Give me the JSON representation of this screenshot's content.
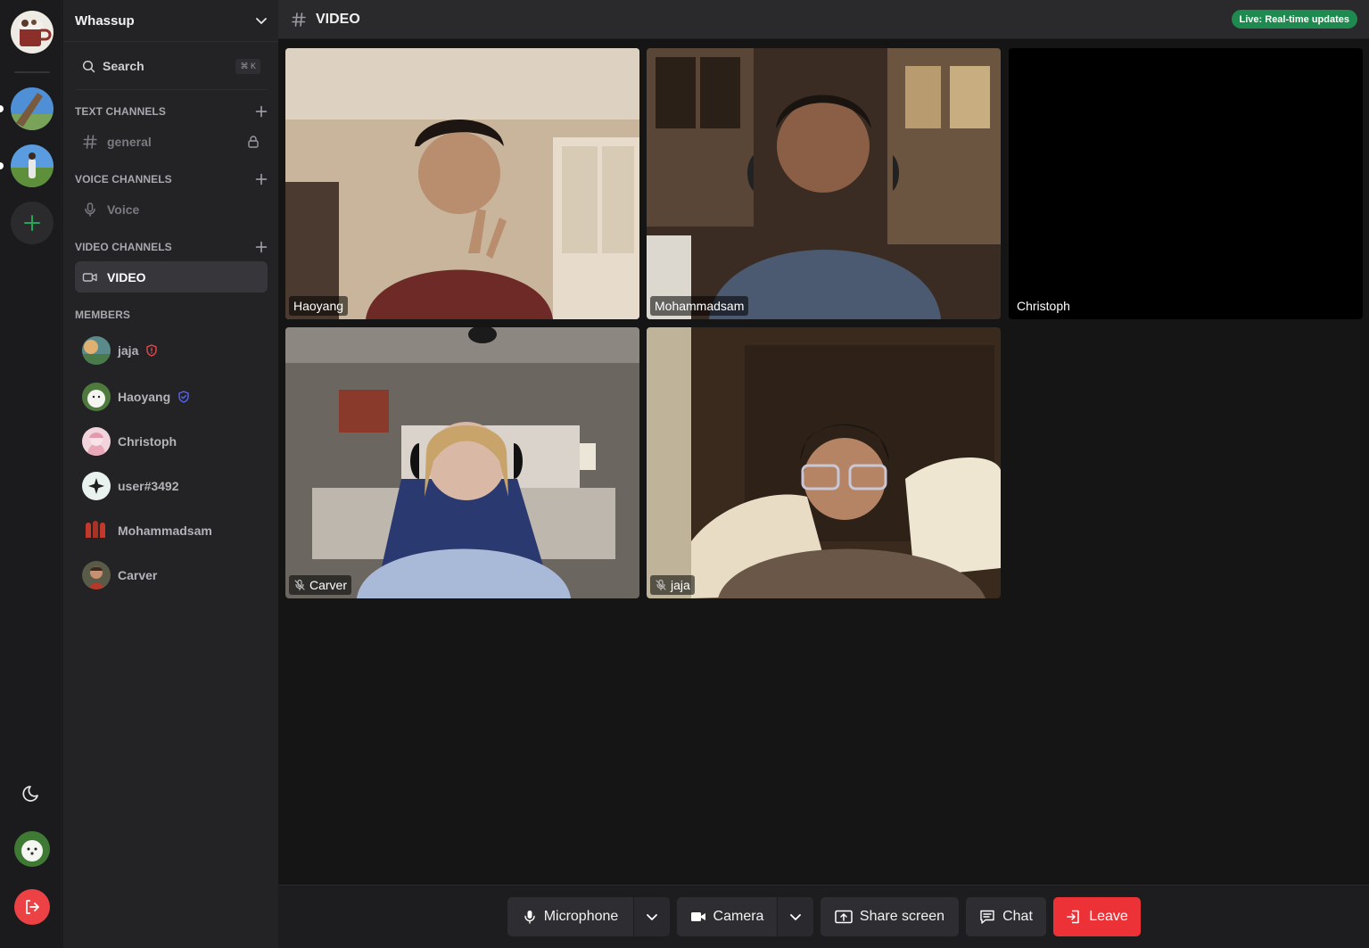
{
  "server": {
    "name": "Whassup"
  },
  "search": {
    "label": "Search",
    "shortcut": "⌘ K"
  },
  "sections": {
    "text": "TEXT CHANNELS",
    "voice": "VOICE CHANNELS",
    "video": "VIDEO CHANNELS",
    "members": "MEMBERS"
  },
  "channels": {
    "text": [
      {
        "label": "general",
        "locked": true
      }
    ],
    "voice": [
      {
        "label": "Voice"
      }
    ],
    "video": [
      {
        "label": "VIDEO",
        "active": true
      }
    ]
  },
  "members": [
    {
      "name": "jaja",
      "badge": "shield-red"
    },
    {
      "name": "Haoyang",
      "badge": "shield-blue"
    },
    {
      "name": "Christoph",
      "badge": ""
    },
    {
      "name": "user#3492",
      "badge": ""
    },
    {
      "name": "Mohammadsam",
      "badge": ""
    },
    {
      "name": "Carver",
      "badge": ""
    }
  ],
  "topbar": {
    "title": "VIDEO",
    "live_badge": "Live: Real-time updates"
  },
  "tiles": [
    {
      "name": "Haoyang",
      "muted": false,
      "video": true
    },
    {
      "name": "Mohammadsam",
      "muted": false,
      "video": true
    },
    {
      "name": "Christoph",
      "muted": false,
      "video": false
    },
    {
      "name": "Carver",
      "muted": true,
      "video": true
    },
    {
      "name": "jaja",
      "muted": true,
      "video": true
    }
  ],
  "controls": {
    "microphone": "Microphone",
    "camera": "Camera",
    "share_screen": "Share screen",
    "chat": "Chat",
    "leave": "Leave"
  },
  "colors": {
    "accent_green": "#1f8a4f",
    "leave_red": "#ed3237",
    "shield_red": "#e5484d",
    "shield_blue": "#5865f2"
  }
}
